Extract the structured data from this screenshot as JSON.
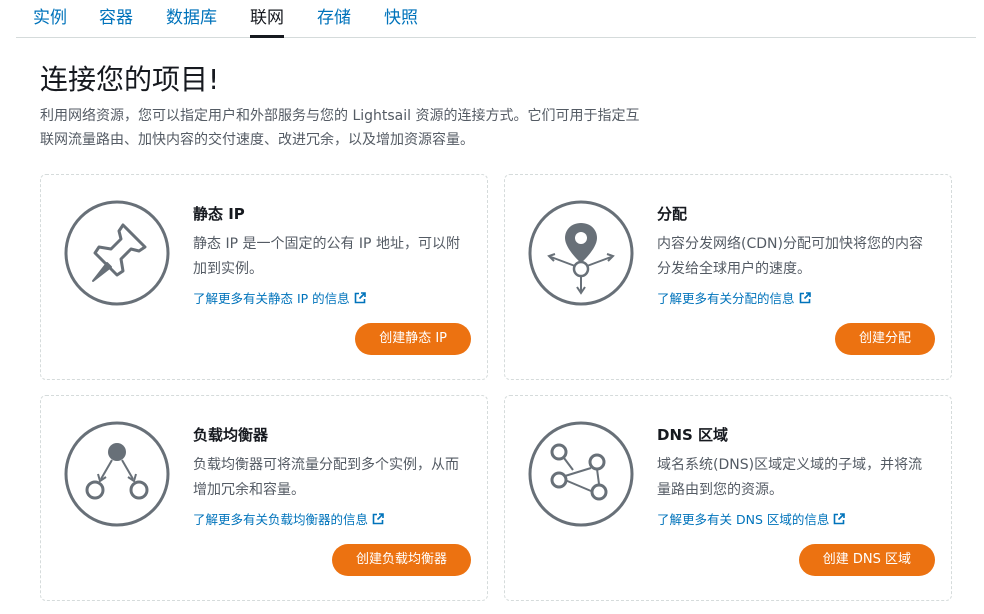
{
  "tabs": [
    {
      "label": "实例"
    },
    {
      "label": "容器"
    },
    {
      "label": "数据库"
    },
    {
      "label": "联网",
      "active": true
    },
    {
      "label": "存储"
    },
    {
      "label": "快照"
    }
  ],
  "page": {
    "title": "连接您的项目!",
    "description": "利用网络资源，您可以指定用户和外部服务与您的 Lightsail 资源的连接方式。它们可用于指定互联网流量路由、加快内容的交付速度、改进冗余，以及增加资源容量。"
  },
  "cards": [
    {
      "icon": "pushpin-icon",
      "title": "静态 IP",
      "description": "静态 IP 是一个固定的公有 IP 地址，可以附加到实例。",
      "link": "了解更多有关静态 IP 的信息",
      "button": "创建静态 IP"
    },
    {
      "icon": "map-pin-distribution-icon",
      "title": "分配",
      "description": "内容分发网络(CDN)分配可加快将您的内容分发给全球用户的速度。",
      "link": "了解更多有关分配的信息",
      "button": "创建分配"
    },
    {
      "icon": "load-balancer-icon",
      "title": "负载均衡器",
      "description": "负载均衡器可将流量分配到多个实例，从而增加冗余和容量。",
      "link": "了解更多有关负载均衡器的信息",
      "button": "创建负载均衡器"
    },
    {
      "icon": "dns-nodes-icon",
      "title": "DNS 区域",
      "description": "域名系统(DNS)区域定义域的子域，并将流量路由到您的资源。",
      "link": "了解更多有关 DNS 区域的信息",
      "button": "创建 DNS 区域"
    }
  ],
  "colors": {
    "accent": "#ec7211",
    "link": "#0073bb",
    "icon_gray": "#687078",
    "text": "#16191f",
    "muted": "#545b64"
  }
}
